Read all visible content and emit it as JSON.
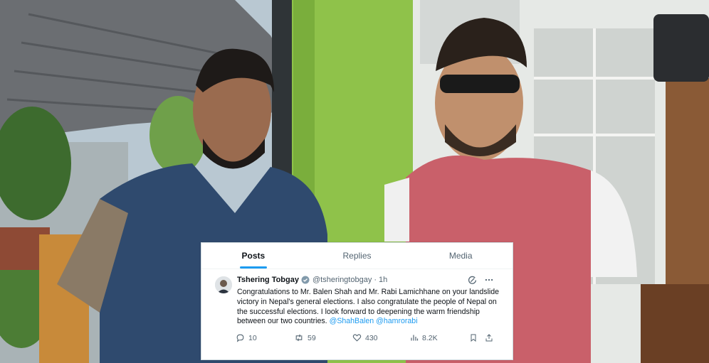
{
  "tabs": [
    {
      "label": "Posts"
    },
    {
      "label": "Replies"
    },
    {
      "label": "Media"
    }
  ],
  "tweet": {
    "author_name": "Tshering Tobgay",
    "handle": "@tsheringtobgay",
    "separator": "·",
    "time": "1h",
    "text_part1": "Congratulations to Mr. Balen Shah and Mr. Rabi Lamichhane on your landslide victory in Nepal's general elections. I also congratulate the people of Nepal on the successful elections. I look forward to deepening the warm friendship between our two countries. ",
    "mention1": "@ShahBalen",
    "mention2": "@hamrorabi"
  },
  "actions": {
    "replies": "10",
    "reposts": "59",
    "likes": "430",
    "views": "8.2K"
  },
  "icons": {
    "verified": "verified-badge-icon",
    "grok": "grok-icon",
    "more": "more-icon",
    "reply": "reply-icon",
    "repost": "repost-icon",
    "like": "like-icon",
    "views": "views-icon",
    "bookmark": "bookmark-icon",
    "share": "share-icon"
  },
  "colors": {
    "accent": "#1d9bf0",
    "text": "#0f1419",
    "muted": "#536471"
  }
}
